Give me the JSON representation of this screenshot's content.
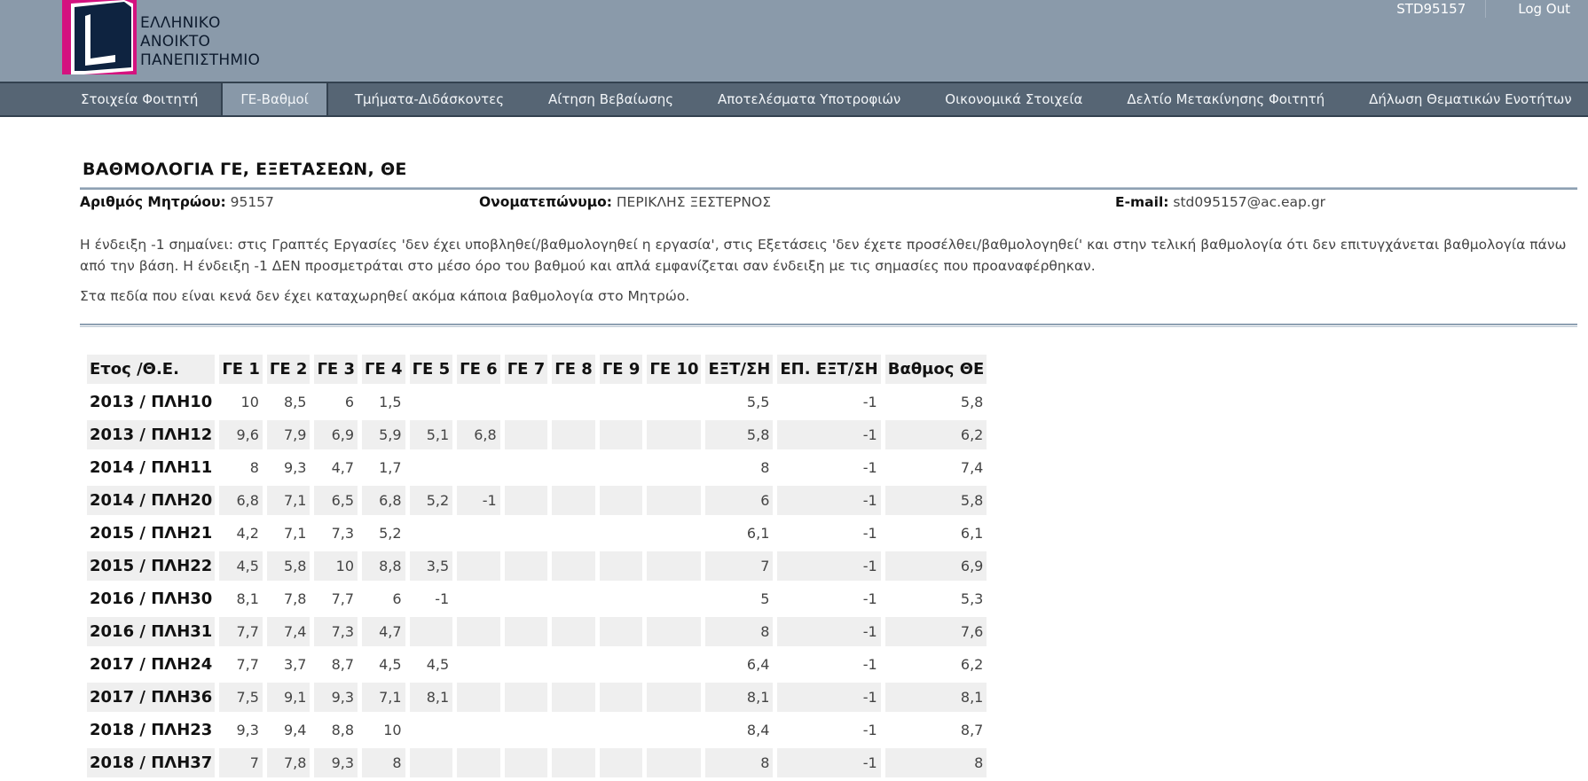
{
  "logo": {
    "line1": "ΕΛΛΗΝΙΚΟ",
    "line2": "ΑΝΟΙΚΤΟ",
    "line3": "ΠΑΝΕΠΙΣΤΗΜΙΟ"
  },
  "user": {
    "id": "STD95157",
    "logout": "Log Out"
  },
  "nav": [
    "Στοιχεία Φοιτητή",
    "ΓΕ-Βαθμοί",
    "Τμήματα-Διδάσκοντες",
    "Αίτηση Βεβαίωσης",
    "Αποτελέσματα Υποτροφιών",
    "Οικονομικά Στοιχεία",
    "Δελτίο Μετακίνησης Φοιτητή",
    "Δήλωση Θεματικών Ενοτήτων"
  ],
  "page_title": "ΒΑΘΜΟΛΟΓΙΑ ΓΕ, ΕΞΕΤΑΣΕΩΝ, ΘΕ",
  "student": {
    "reg_label": "Αριθμός Μητρώου:",
    "reg_value": "95157",
    "name_label": "Ονοματεπώνυμο:",
    "name_value": "ΠΕΡΙΚΛΗΣ ΞΕΣΤΕΡΝΟΣ",
    "email_label": "E-mail:",
    "email_value": "std095157@ac.eap.gr"
  },
  "notes": {
    "p1": "Η ένδειξη -1 σημαίνει: στις Γραπτές Εργασίες 'δεν έχει υποβληθεί/βαθμολογηθεί η εργασία', στις Εξετάσεις 'δεν έχετε προσέλθει/βαθμολογηθεί' και στην τελική βαθμολογία ότι δεν επιτυγχάνεται βαθμολογία πάνω από την βάση. Η ένδειξη -1 ΔΕΝ προσμετράται στο μέσο όρο του βαθμού και απλά εμφανίζεται σαν ένδειξη με τις σημασίες που προαναφέρθηκαν.",
    "p2": "Στα πεδία που είναι κενά δεν έχει καταχωρηθεί ακόμα κάποια βαθμολογία στο Μητρώο."
  },
  "table": {
    "headers": [
      "Ετος /Θ.Ε.",
      "ΓΕ 1",
      "ΓΕ 2",
      "ΓΕ 3",
      "ΓΕ 4",
      "ΓΕ 5",
      "ΓΕ 6",
      "ΓΕ 7",
      "ΓΕ 8",
      "ΓΕ 9",
      "ΓΕ 10",
      "ΕΞΤ/ΣΗ",
      "ΕΠ. ΕΞΤ/ΣΗ",
      "Βαθμος ΘΕ"
    ],
    "rows": [
      [
        "2013 / ΠΛΗ10",
        "10",
        "8,5",
        "6",
        "1,5",
        "",
        "",
        "",
        "",
        "",
        "",
        "5,5",
        "-1",
        "5,8"
      ],
      [
        "2013 / ΠΛΗ12",
        "9,6",
        "7,9",
        "6,9",
        "5,9",
        "5,1",
        "6,8",
        "",
        "",
        "",
        "",
        "5,8",
        "-1",
        "6,2"
      ],
      [
        "2014 / ΠΛΗ11",
        "8",
        "9,3",
        "4,7",
        "1,7",
        "",
        "",
        "",
        "",
        "",
        "",
        "8",
        "-1",
        "7,4"
      ],
      [
        "2014 / ΠΛΗ20",
        "6,8",
        "7,1",
        "6,5",
        "6,8",
        "5,2",
        "-1",
        "",
        "",
        "",
        "",
        "6",
        "-1",
        "5,8"
      ],
      [
        "2015 / ΠΛΗ21",
        "4,2",
        "7,1",
        "7,3",
        "5,2",
        "",
        "",
        "",
        "",
        "",
        "",
        "6,1",
        "-1",
        "6,1"
      ],
      [
        "2015 / ΠΛΗ22",
        "4,5",
        "5,8",
        "10",
        "8,8",
        "3,5",
        "",
        "",
        "",
        "",
        "",
        "7",
        "-1",
        "6,9"
      ],
      [
        "2016 / ΠΛΗ30",
        "8,1",
        "7,8",
        "7,7",
        "6",
        "-1",
        "",
        "",
        "",
        "",
        "",
        "5",
        "-1",
        "5,3"
      ],
      [
        "2016 / ΠΛΗ31",
        "7,7",
        "7,4",
        "7,3",
        "4,7",
        "",
        "",
        "",
        "",
        "",
        "",
        "8",
        "-1",
        "7,6"
      ],
      [
        "2017 / ΠΛΗ24",
        "7,7",
        "3,7",
        "8,7",
        "4,5",
        "4,5",
        "",
        "",
        "",
        "",
        "",
        "6,4",
        "-1",
        "6,2"
      ],
      [
        "2017 / ΠΛΗ36",
        "7,5",
        "9,1",
        "9,3",
        "7,1",
        "8,1",
        "",
        "",
        "",
        "",
        "",
        "8,1",
        "-1",
        "8,1"
      ],
      [
        "2018 / ΠΛΗ23",
        "9,3",
        "9,4",
        "8,8",
        "10",
        "",
        "",
        "",
        "",
        "",
        "",
        "8,4",
        "-1",
        "8,7"
      ],
      [
        "2018 / ΠΛΗ37",
        "7",
        "7,8",
        "9,3",
        "8",
        "",
        "",
        "",
        "",
        "",
        "",
        "8",
        "-1",
        "8"
      ]
    ]
  }
}
